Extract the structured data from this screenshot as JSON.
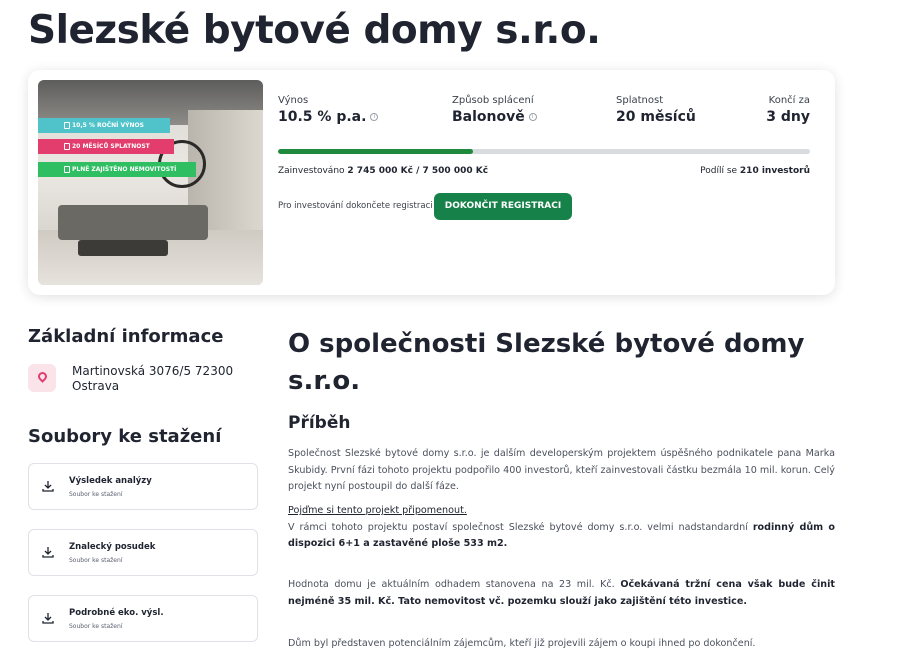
{
  "page": {
    "title": "Slezské bytové domy s.r.o."
  },
  "card": {
    "tags": [
      {
        "text": "10,5 % ROČNÍ VÝNOS"
      },
      {
        "text": "20 MĚSÍCŮ SPLATNOST"
      },
      {
        "text": "PLNĚ ZAJIŠTĚNO NEMOVITOSTÍ"
      }
    ],
    "stats": {
      "yield_label": "Výnos",
      "yield_value": "10.5 % p.a.",
      "repayment_label": "Způsob splácení",
      "repayment_value": "Balonově",
      "maturity_label": "Splatnost",
      "maturity_value": "20 měsíců",
      "ends_label": "Končí za",
      "ends_value": "3 dny"
    },
    "progress_fraction": 0.366,
    "invested_label": "Zainvestováno",
    "invested_value": "2 745 000 Kč / 7 500 000 Kč",
    "investors_label": "Podílí se",
    "investors_value": "210 investorů",
    "register_hint": "Pro investování dokončete registraci",
    "register_button": "DOKONČIT REGISTRACI",
    "colors": {
      "accent": "#17814a",
      "progress_track": "#d9dcdf",
      "tag1": "#4fc3c9",
      "tag2": "#e23d6d",
      "tag3": "#2fbf62"
    }
  },
  "basic_info": {
    "title": "Základní informace",
    "address_line1": "Martinovská 3076/5 72300",
    "address_line2": "Ostrava",
    "icon": "location-pin-icon"
  },
  "downloads": {
    "title": "Soubory ke stažení",
    "files": [
      {
        "name": "Výsledek analýzy",
        "sub": "Soubor ke stažení",
        "icon": "download-icon"
      },
      {
        "name": "Znalecký posudek",
        "sub": "Soubor ke stažení",
        "icon": "download-icon"
      },
      {
        "name": "Podrobné eko. výsl.",
        "sub": "Soubor ke stažení",
        "icon": "download-icon"
      }
    ]
  },
  "about": {
    "title": "O společnosti Slezské bytové domy s.r.o.",
    "story_title": "Příběh",
    "p1": "Společnost Slezské bytové domy s.r.o.  je dalším developerským projektem úspěšného podnikatele pana Marka Skubidy. První fázi tohoto projektu podpořilo 400 investorů, kteří zainvestovali částku bezmála 10 mil. korun. Celý projekt nyní postoupil do další fáze.",
    "link": "Pojďme si tento projekt připomenout.",
    "p2_text": "V rámci tohoto projektu postaví společnost Slezské bytové domy s.r.o. velmi nadstandardní ",
    "p2_bold": "rodinný dům o dispozici 6+1 a zastavěné ploše 533 m2.",
    "p3_text": "Hodnota domu je aktuálním odhadem stanovena na 23 mil. Kč. ",
    "p3_bold": "Očekávaná tržní cena však bude činit nejméně 35 mil. Kč. Tato nemovitost vč. pozemku slouží jako zajištění této investice.",
    "p4": "Dům byl představen potenciálním zájemcům, kteří již projevili zájem o koupi ihned po dokončení."
  }
}
